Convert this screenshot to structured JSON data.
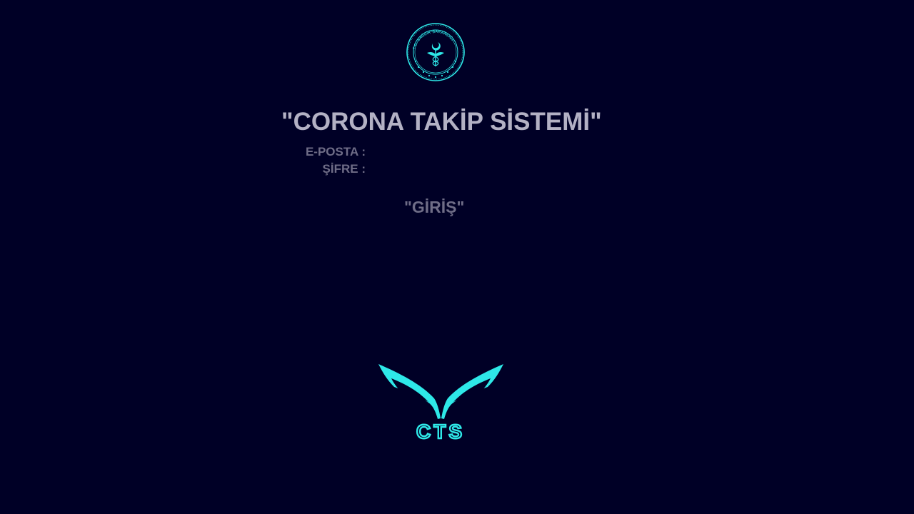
{
  "app": {
    "title": "\"CORONA TAKİP SİSTEMİ\""
  },
  "seal": {
    "icon": "ministry-of-health-seal-icon",
    "text": "T.C. SAĞLIK BAKANLIĞI"
  },
  "form": {
    "email_label": "E-POSTA :",
    "email_value": "",
    "password_label": "ŞİFRE :",
    "password_value": "",
    "login_label": "\"GİRİŞ\""
  },
  "brand": {
    "icon": "cts-wings-logo-icon",
    "text": "CTS"
  },
  "colors": {
    "background": "#000026",
    "title": "#b3b1c4",
    "label": "#6f6d87",
    "accent": "#2ee8e8"
  }
}
